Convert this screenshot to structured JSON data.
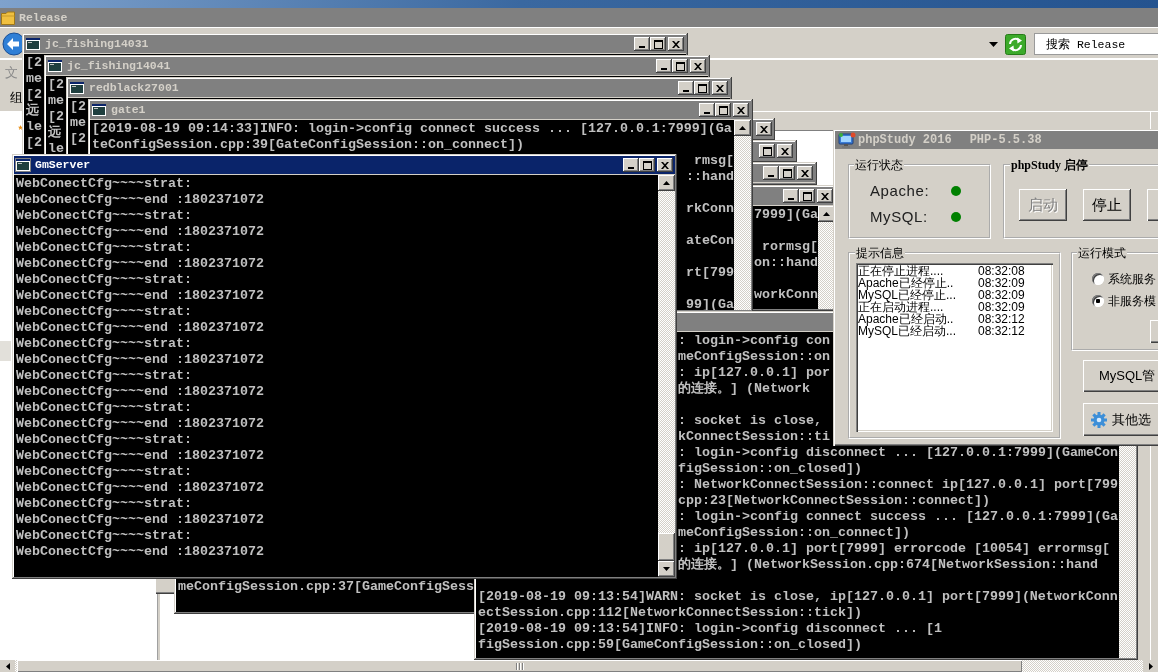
{
  "explorer": {
    "title": "Release",
    "active": false,
    "menu_item": "文",
    "toolbar_item": "组",
    "search": {
      "placeholder": "搜索 Release"
    }
  },
  "console_windows": [
    {
      "title": "jc_fishing14031",
      "active": false,
      "rows": [
        {
          "kind": "line",
          "text": "[2"
        },
        {
          "kind": "line",
          "text": "me"
        },
        {
          "kind": "line",
          "text": "[2"
        },
        {
          "kind": "line",
          "text": "远"
        },
        {
          "kind": "line",
          "text": "le"
        },
        {
          "kind": "line",
          "text": "[2"
        }
      ]
    },
    {
      "title": "jc_fishing14041",
      "active": false,
      "rows": [
        {
          "kind": "line",
          "text": "[2"
        },
        {
          "kind": "line",
          "text": "me"
        },
        {
          "kind": "line",
          "text": "[2"
        },
        {
          "kind": "line",
          "text": "远"
        },
        {
          "kind": "line",
          "text": "le"
        }
      ]
    },
    {
      "title": "redblack27001",
      "active": false,
      "rows": [
        {
          "kind": "line",
          "text": "[2"
        },
        {
          "kind": "line",
          "text": "me"
        },
        {
          "kind": "line",
          "text": "[2"
        }
      ]
    },
    {
      "active": false
    },
    {
      "active": false
    },
    {
      "active": false
    },
    {
      "active": false,
      "rows": [
        {
          "kind": "end",
          "text": "7999](Ga"
        },
        {
          "kind": "blank"
        },
        {
          "kind": "end",
          "text": "rormsg["
        },
        {
          "kind": "end",
          "text": "on::hand"
        },
        {
          "kind": "blank"
        },
        {
          "kind": "end",
          "text": "workConn"
        }
      ]
    },
    {
      "title": "gate1",
      "active": false,
      "rows": [
        {
          "kind": "line",
          "text": "[2019-08-19 09:14:33]INFO: login->config connect success ... [127.0.0.1:7999](Ga"
        },
        {
          "kind": "line",
          "text": "teConfigSession.cpp:39[GateConfigSession::on_connect])"
        },
        {
          "kind": "end",
          "text": "rmsg["
        },
        {
          "kind": "end",
          "text": "::hand"
        },
        {
          "kind": "blank"
        },
        {
          "kind": "end",
          "text": "rkConn"
        },
        {
          "kind": "blank"
        },
        {
          "kind": "end",
          "text": "ateCon"
        },
        {
          "kind": "blank"
        },
        {
          "kind": "end",
          "text": "rt[799"
        },
        {
          "kind": "blank"
        },
        {
          "kind": "end",
          "text": "99](Ga"
        }
      ]
    },
    {
      "rows": [
        {
          "kind": "line",
          "text": "meConfigSession.cpp:37[GameConfigSess"
        }
      ]
    },
    {
      "active": false,
      "rows": [
        {
          "kind": "cut",
          "text": ": login->config con"
        },
        {
          "kind": "cut",
          "text": "meConfigSession::on"
        },
        {
          "kind": "cut",
          "text": ": ip[127.0.0.1] por"
        },
        {
          "kind": "cut",
          "text": "的连接。] (Network"
        },
        {
          "kind": "blank"
        },
        {
          "kind": "cut",
          "text": ": socket is close,"
        },
        {
          "kind": "cut",
          "text": "kConnectSession::ti"
        },
        {
          "kind": "cut",
          "text": ": login->config disconnect ... [127.0.0.1:7999](GameCon"
        },
        {
          "kind": "cut",
          "text": "figSession::on_closed])"
        },
        {
          "kind": "cut",
          "text": ": NetworkConnectSession::connect ip[127.0.0.1] port[799"
        },
        {
          "kind": "cut",
          "text": "cpp:23[NetworkConnectSession::connect])"
        },
        {
          "kind": "cut",
          "text": ": login->config connect success ... [127.0.0.1:7999](Ga"
        },
        {
          "kind": "cut",
          "text": "meConfigSession::on_connect])"
        },
        {
          "kind": "cut",
          "text": ": ip[127.0.0.1] port[7999] errorcode [10054] errormsg["
        },
        {
          "kind": "cut",
          "text": "的连接。] (NetworkSession.cpp:674[NetworkSession::hand"
        },
        {
          "kind": "blank"
        },
        {
          "kind": "line",
          "text": "[2019-08-19 09:13:54]WARN: socket is close, ip[127.0.0.1] port[7999](NetworkConn"
        },
        {
          "kind": "line",
          "text": "ectSession.cpp:112[NetworkConnectSession::tick])"
        },
        {
          "kind": "line",
          "text": "[2019-08-19 09:13:54]INFO: login->config disconnect ... [1"
        },
        {
          "kind": "line",
          "text": "figSession.cpp:59[GameConfigSession::on_closed])"
        }
      ]
    },
    {
      "title": "GmServer",
      "active": true,
      "rows": [
        {
          "kind": "line",
          "text": "WebConectCfg~~~~strat:"
        },
        {
          "kind": "line",
          "text": "WebConectCfg~~~~end :1802371072"
        },
        {
          "kind": "line",
          "text": "WebConectCfg~~~~strat:"
        },
        {
          "kind": "line",
          "text": "WebConectCfg~~~~end :1802371072"
        },
        {
          "kind": "line",
          "text": "WebConectCfg~~~~strat:"
        },
        {
          "kind": "line",
          "text": "WebConectCfg~~~~end :1802371072"
        },
        {
          "kind": "line",
          "text": "WebConectCfg~~~~strat:"
        },
        {
          "kind": "line",
          "text": "WebConectCfg~~~~end :1802371072"
        },
        {
          "kind": "line",
          "text": "WebConectCfg~~~~strat:"
        },
        {
          "kind": "line",
          "text": "WebConectCfg~~~~end :1802371072"
        },
        {
          "kind": "line",
          "text": "WebConectCfg~~~~strat:"
        },
        {
          "kind": "line",
          "text": "WebConectCfg~~~~end :1802371072"
        },
        {
          "kind": "line",
          "text": "WebConectCfg~~~~strat:"
        },
        {
          "kind": "line",
          "text": "WebConectCfg~~~~end :1802371072"
        },
        {
          "kind": "line",
          "text": "WebConectCfg~~~~strat:"
        },
        {
          "kind": "line",
          "text": "WebConectCfg~~~~end :1802371072"
        },
        {
          "kind": "line",
          "text": "WebConectCfg~~~~strat:"
        },
        {
          "kind": "line",
          "text": "WebConectCfg~~~~end :1802371072"
        },
        {
          "kind": "line",
          "text": "WebConectCfg~~~~strat:"
        },
        {
          "kind": "line",
          "text": "WebConectCfg~~~~end :1802371072"
        },
        {
          "kind": "line",
          "text": "WebConectCfg~~~~strat:"
        },
        {
          "kind": "line",
          "text": "WebConectCfg~~~~end :1802371072"
        },
        {
          "kind": "line",
          "text": "WebConectCfg~~~~strat:"
        },
        {
          "kind": "line",
          "text": "WebConectCfg~~~~end :1802371072"
        }
      ]
    }
  ],
  "php_study": {
    "title": "phpStudy 2016",
    "version": "PHP-5.5.38",
    "active": false,
    "status_group": {
      "label": "运行状态",
      "services": [
        {
          "name": "Apache:",
          "running": true
        },
        {
          "name": "MySQL:",
          "running": true
        }
      ]
    },
    "control_group": {
      "label": "phpStudy 启停",
      "buttons": [
        {
          "label": "启动",
          "disabled": true
        },
        {
          "label": "停止",
          "disabled": false
        }
      ]
    },
    "log_group": {
      "label": "提示信息",
      "entries": [
        {
          "message": "正在停止进程....",
          "time": "08:32:08"
        },
        {
          "message": "Apache已经停止..",
          "time": "08:32:09"
        },
        {
          "message": "MySQL已经停止...",
          "time": "08:32:09"
        },
        {
          "message": "正在启动进程....",
          "time": "08:32:09"
        },
        {
          "message": "Apache已经启动..",
          "time": "08:32:12"
        },
        {
          "message": "MySQL已经启动...",
          "time": "08:32:12"
        }
      ]
    },
    "mode_group": {
      "label": "运行模式",
      "options": [
        {
          "label": "系统服务",
          "selected": false
        },
        {
          "label": "非服务模",
          "selected": true
        }
      ]
    },
    "buttons": [
      {
        "label": "MySQL管",
        "kind": "text"
      },
      {
        "label": "其他选",
        "kind": "icon_text"
      }
    ]
  }
}
